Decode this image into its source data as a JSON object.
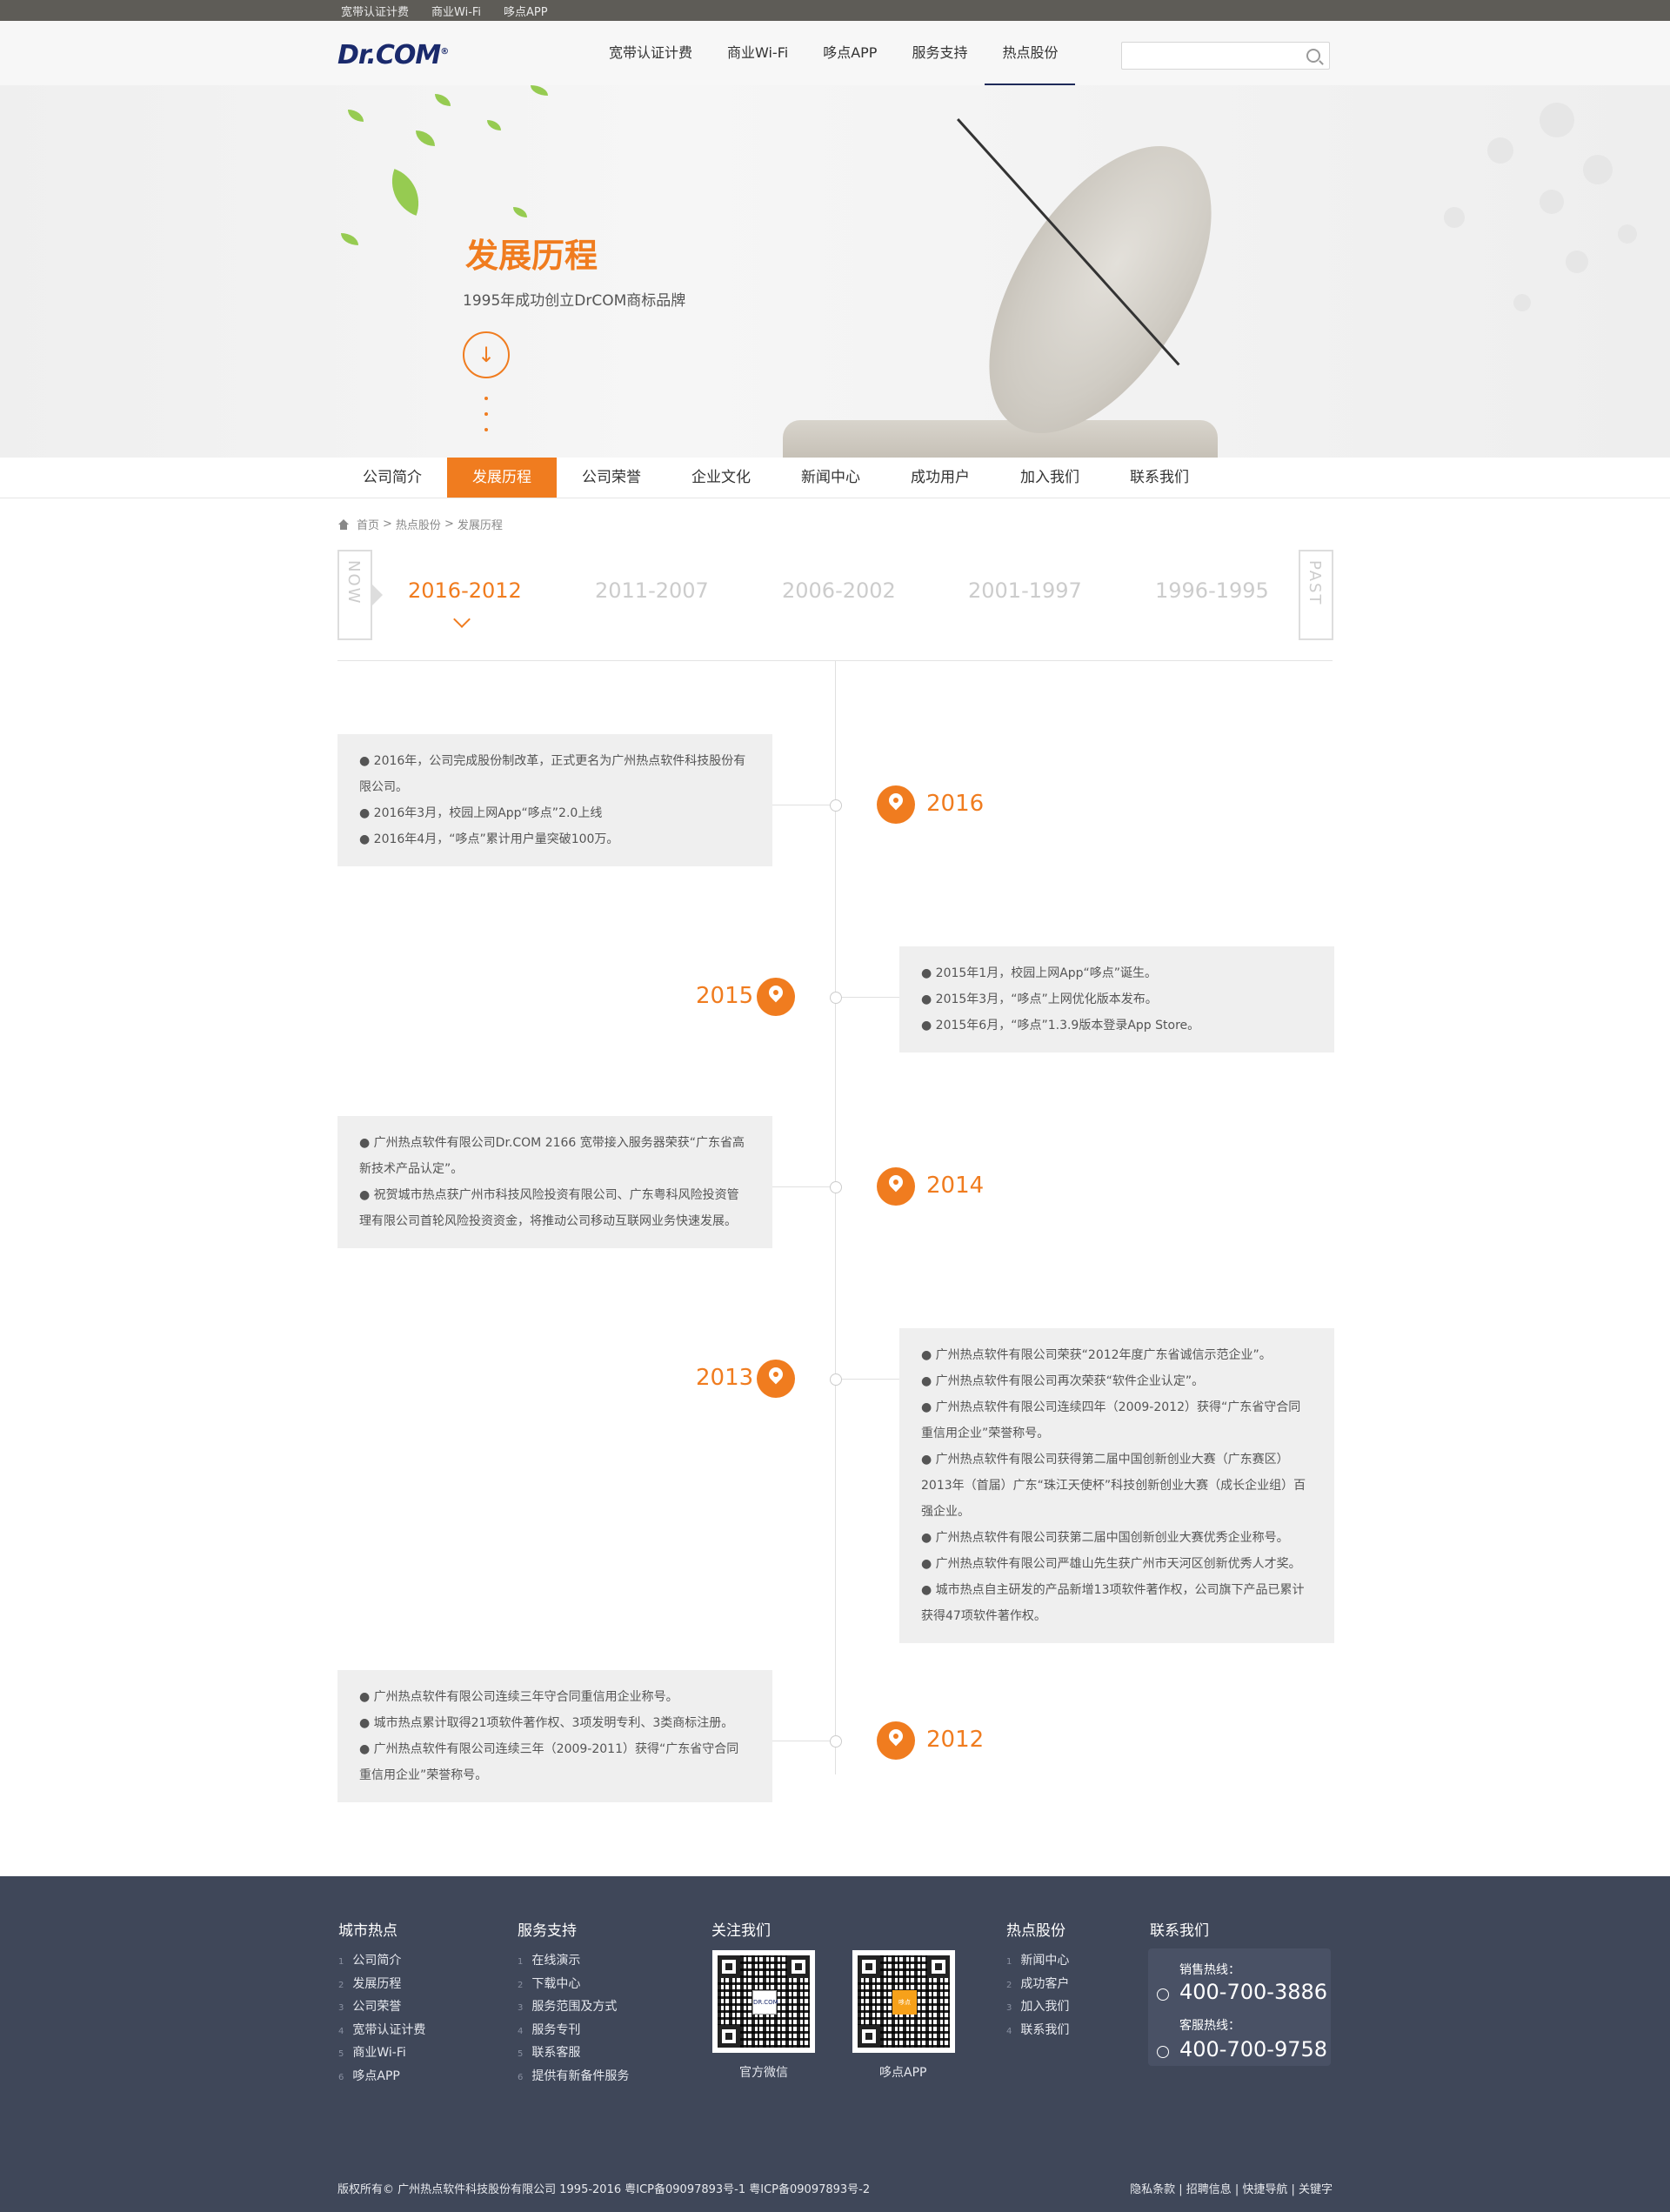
{
  "topbar": {
    "links": [
      "宽带认证计费",
      "商业Wi-Fi",
      "哆点APP"
    ]
  },
  "header": {
    "logo": "Dr.COM",
    "nav": [
      "宽带认证计费",
      "商业Wi-Fi",
      "哆点APP",
      "服务支持",
      "热点股份"
    ],
    "active_nav": "热点股份",
    "search_placeholder": ""
  },
  "banner": {
    "title": "发展历程",
    "subtitle": "1995年成功创立DrCOM商标品牌"
  },
  "subnav": {
    "tabs": [
      "公司简介",
      "发展历程",
      "公司荣誉",
      "企业文化",
      "新闻中心",
      "成功用户",
      "加入我们",
      "联系我们"
    ],
    "active": "发展历程"
  },
  "breadcrumb": {
    "home": "首页",
    "sep": ">",
    "parent": "热点股份",
    "current": "发展历程"
  },
  "year_tabs": {
    "now": "NOW",
    "past": "PAST",
    "ranges": [
      "2016-2012",
      "2011-2007",
      "2006-2002",
      "2001-1997",
      "1996-1995"
    ],
    "active": "2016-2012"
  },
  "timeline": [
    {
      "year": "2016",
      "items": [
        "● 2016年，公司完成股份制改革，正式更名为广州热点软件科技股份有限公司。",
        "● 2016年3月，校园上网App“哆点”2.0上线",
        "● 2016年4月，“哆点”累计用户量突破100万。"
      ]
    },
    {
      "year": "2015",
      "items": [
        "● 2015年1月，校园上网App“哆点”诞生。",
        "● 2015年3月，“哆点”上网优化版本发布。",
        "● 2015年6月，“哆点”1.3.9版本登录App Store。"
      ]
    },
    {
      "year": "2014",
      "items": [
        "● 广州热点软件有限公司Dr.COM 2166 宽带接入服务器荣获“广东省高新技术产品认定”。",
        "● 祝贺城市热点获广州市科技风险投资有限公司、广东粤科风险投资管理有限公司首轮风险投资资金，将推动公司移动互联网业务快速发展。"
      ]
    },
    {
      "year": "2013",
      "items": [
        "● 广州热点软件有限公司荣获“2012年度广东省诚信示范企业”。",
        "● 广州热点软件有限公司再次荣获“软件企业认定”。",
        "● 广州热点软件有限公司连续四年（2009-2012）获得“广东省守合同重信用企业”荣誉称号。",
        "● 广州热点软件有限公司获得第二届中国创新创业大赛（广东赛区）2013年（首届）广东“珠江天使杯”科技创新创业大赛（成长企业组）百强企业。",
        "● 广州热点软件有限公司获第二届中国创新创业大赛优秀企业称号。",
        "● 广州热点软件有限公司严雄山先生获广州市天河区创新优秀人才奖。",
        "● 城市热点自主研发的产品新增13项软件著作权，公司旗下产品已累计获得47项软件著作权。"
      ]
    },
    {
      "year": "2012",
      "items": [
        "● 广州热点软件有限公司连续三年守合同重信用企业称号。",
        "● 城市热点累计取得21项软件著作权、3项发明专利、3类商标注册。",
        "● 广州热点软件有限公司连续三年（2009-2011）获得“广东省守合同重信用企业”荣誉称号。"
      ]
    }
  ],
  "footer": {
    "col1": {
      "title": "城市热点",
      "items": [
        "公司简介",
        "发展历程",
        "公司荣誉",
        "宽带认证计费",
        "商业Wi-Fi",
        "哆点APP"
      ]
    },
    "col2": {
      "title": "服务支持",
      "items": [
        "在线演示",
        "下载中心",
        "服务范围及方式",
        "服务专刊",
        "联系客服",
        "提供有新备件服务"
      ]
    },
    "col3": {
      "title": "关注我们",
      "qr1_label": "官方微信",
      "qr2_label": "哆点APP",
      "qr1_center": "DR.COM",
      "qr2_center": "哆点"
    },
    "col4": {
      "title": "热点股份",
      "items": [
        "新闻中心",
        "成功客户",
        "加入我们",
        "联系我们"
      ]
    },
    "col5": {
      "title": "联系我们",
      "sales_label": "销售热线：",
      "sales_number": "400-700-3886",
      "service_label": "客服热线：",
      "service_number": "400-700-9758"
    },
    "copyright": "版权所有© 广州热点软件科技股份有限公司 1995-2016 粤ICP备09097893号-1 粤ICP备09097893号-2",
    "links": "隐私条款 | 招聘信息 | 快捷导航 | 关键字"
  },
  "colors": {
    "accent": "#f07c1f",
    "footer_bg": "#3f4759",
    "nav_underline": "#1e2a5a"
  }
}
